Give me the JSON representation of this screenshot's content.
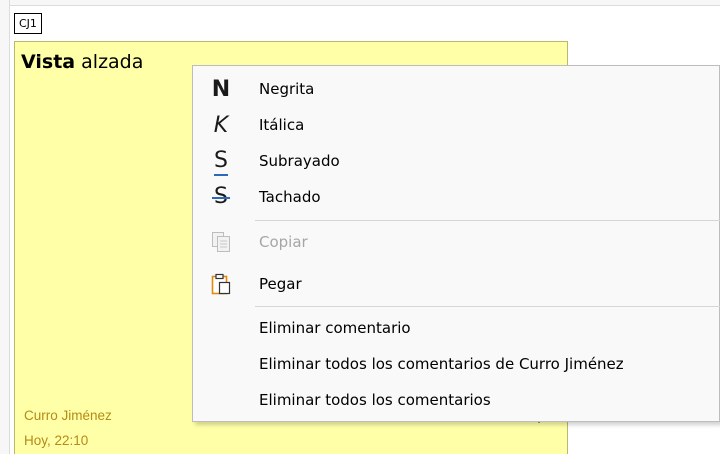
{
  "comment_tag": "CJ1",
  "note": {
    "title_bold": "Vista",
    "title_rest": " alzada",
    "author": "Curro Jiménez",
    "date": "Hoy, 22:10",
    "menu_button_icon": "chevron-down-icon"
  },
  "context_menu": {
    "items": [
      {
        "label": "Negrita",
        "icon": "bold-icon",
        "glyph": "N",
        "enabled": true
      },
      {
        "label": "Itálica",
        "icon": "italic-icon",
        "glyph": "K",
        "enabled": true
      },
      {
        "label": "Subrayado",
        "icon": "underline-icon",
        "glyph": "S",
        "enabled": true
      },
      {
        "label": "Tachado",
        "icon": "strikethrough-icon",
        "glyph": "S",
        "enabled": true
      },
      {
        "label": "Copiar",
        "icon": "copy-icon",
        "enabled": false
      },
      {
        "label": "Pegar",
        "icon": "paste-icon",
        "enabled": true
      },
      {
        "label": "Eliminar comentario",
        "enabled": true
      },
      {
        "label": "Eliminar todos los comentarios de Curro Jiménez",
        "enabled": true
      },
      {
        "label": "Eliminar todos los comentarios",
        "enabled": true
      }
    ]
  },
  "colors": {
    "note_background": "#ffffa8",
    "author_text": "#b58a15",
    "accent_blue": "#2a6ab8",
    "disabled_text": "#a6a6a6"
  }
}
